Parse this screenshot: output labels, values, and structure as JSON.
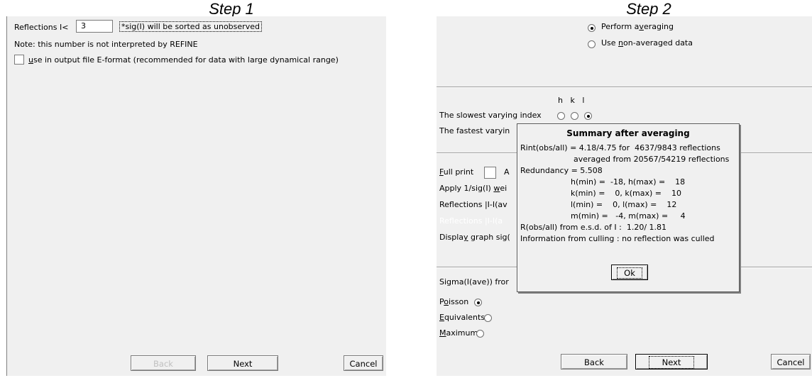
{
  "step1": {
    "title": "Step 1",
    "reflections_label": "Reflections I<",
    "reflections_value": "3",
    "sig_label": "*sig(I) will be sorted as unobserved",
    "note": "Note: this number is not interpreted by REFINE",
    "eformat_label_u": "u",
    "eformat_label_rest": "se in output file E-format (recommended for data with large dynamical range)",
    "buttons": {
      "back": "Back",
      "next": "Next",
      "cancel": "Cancel"
    }
  },
  "step2": {
    "title": "Step 2",
    "perform_averaging": {
      "pre": "Perform a",
      "u": "v",
      "post": "eraging"
    },
    "use_non_averaged": {
      "pre": "Use ",
      "u": "n",
      "post": "on-averaged data"
    },
    "hkl_header": "h   k   l",
    "slowest_label": "The slowest varying index",
    "fastest_label": "The fastest varyin",
    "full_print": {
      "u": "F",
      "rest": "ull print"
    },
    "full_print_trail": "A",
    "apply_weight": {
      "pre": "Apply 1/sig(I) ",
      "u": "w",
      "post": "ei"
    },
    "reflections1": "Reflections |I-I(av",
    "reflections2": "Reflections |I-I(a",
    "display_graph": {
      "pre": "Displa",
      "u": "y",
      "post": " graph sig("
    },
    "sigma_label": "Sigma(I(ave)) fror",
    "poisson": {
      "pre": "P",
      "u": "o",
      "post": "isson"
    },
    "equivalents": {
      "u": "E",
      "rest": "quivalents"
    },
    "maximum": {
      "u": "M",
      "rest": "aximum"
    },
    "buttons": {
      "back": "Back",
      "next": "Next",
      "cancel": "Cancel"
    }
  },
  "summary_dialog": {
    "title": "Summary after averaging",
    "lines": [
      "Rint(obs/all) = 4.18/4.75 for  4637/9843 reflections",
      "averaged from 20567/54219 reflections",
      "Redundancy = 5.508",
      "h(min) =  -18, h(max) =    18",
      "k(min) =    0, k(max) =    10",
      "l(min) =    0, l(max) =    12",
      "m(min) =   -4, m(max) =     4",
      "R(obs/all) from e.s.d. of I :  1.20/ 1.81",
      "Information from culling : no reflection was culled"
    ],
    "ok": "Ok"
  }
}
